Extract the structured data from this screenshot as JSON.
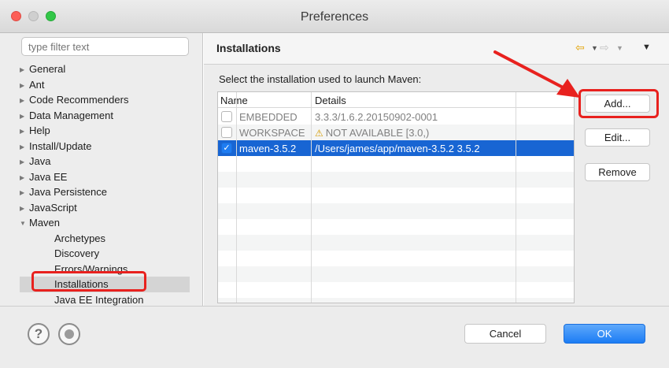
{
  "window": {
    "title": "Preferences"
  },
  "sidebar": {
    "filter_placeholder": "type filter text",
    "items": [
      {
        "label": "General",
        "expander": "collapsed"
      },
      {
        "label": "Ant",
        "expander": "collapsed"
      },
      {
        "label": "Code Recommenders",
        "expander": "collapsed"
      },
      {
        "label": "Data Management",
        "expander": "collapsed"
      },
      {
        "label": "Help",
        "expander": "collapsed"
      },
      {
        "label": "Install/Update",
        "expander": "collapsed"
      },
      {
        "label": "Java",
        "expander": "collapsed"
      },
      {
        "label": "Java EE",
        "expander": "collapsed"
      },
      {
        "label": "Java Persistence",
        "expander": "collapsed"
      },
      {
        "label": "JavaScript",
        "expander": "collapsed"
      },
      {
        "label": "Maven",
        "expander": "expanded"
      },
      {
        "label": "Archetypes"
      },
      {
        "label": "Discovery"
      },
      {
        "label": "Errors/Warnings"
      },
      {
        "label": "Installations",
        "selected": true
      },
      {
        "label": "Java EE Integration"
      }
    ]
  },
  "panel": {
    "title": "Installations",
    "caption": "Select the installation used to launch Maven:",
    "columns": {
      "name": "Name",
      "details": "Details"
    },
    "rows": [
      {
        "checked": false,
        "name": "EMBEDDED",
        "details": "3.3.3/1.6.2.20150902-0001",
        "warning": false
      },
      {
        "checked": false,
        "name": "WORKSPACE",
        "details": "NOT AVAILABLE [3.0,)",
        "warning": true
      },
      {
        "checked": true,
        "name": "maven-3.5.2",
        "details": "/Users/james/app/maven-3.5.2 3.5.2",
        "warning": false
      }
    ],
    "buttons": {
      "add": "Add...",
      "edit": "Edit...",
      "remove": "Remove"
    }
  },
  "footer": {
    "cancel": "Cancel",
    "ok": "OK"
  },
  "icons": {
    "back": "arrow-left-icon",
    "forward": "arrow-right-icon",
    "view_menu": "view-menu-icon",
    "help": "help-icon",
    "record": "record-icon",
    "warning": "warning-icon"
  },
  "colors": {
    "selection": "#1865d3",
    "annotation": "#e8211e",
    "ok_button": "#1c7cf4",
    "checkbox_on": "#1e7cf2"
  }
}
